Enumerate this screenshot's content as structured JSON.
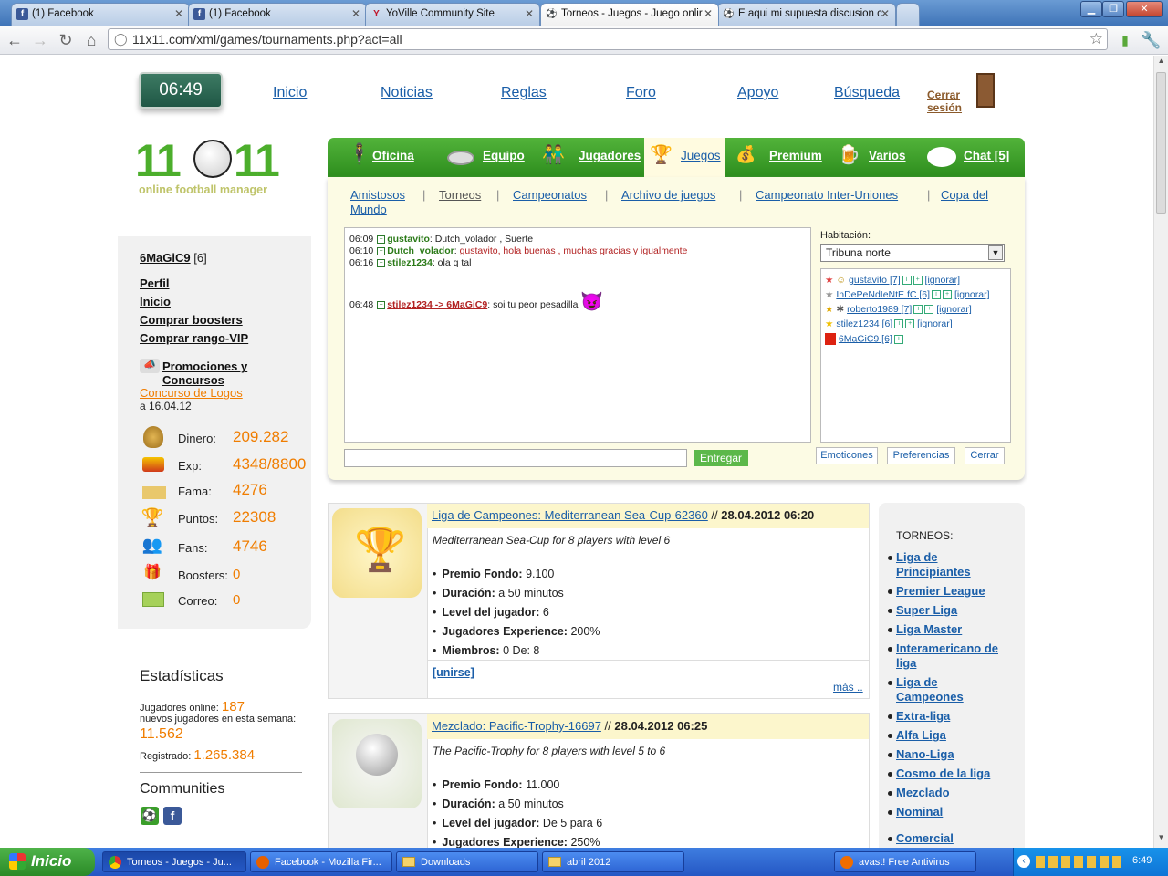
{
  "browser": {
    "tabs": [
      {
        "label": "(1) Facebook",
        "icon": "facebook-icon",
        "color": "#3b5998"
      },
      {
        "label": "(1) Facebook",
        "icon": "facebook-icon",
        "color": "#3b5998"
      },
      {
        "label": "YoVille Community Site",
        "icon": "yoville-icon",
        "color": "#c0152a"
      },
      {
        "label": "Torneos - Juegos - Juego onlir",
        "icon": "soccer-ball-icon",
        "color": "#000000"
      },
      {
        "label": "E aqui mi supuesta discusion c",
        "icon": "soccer-ball-icon",
        "color": "#000000"
      }
    ],
    "url": "11x11.com/xml/games/tournaments.php?act=all"
  },
  "header": {
    "clock": "06:49",
    "nav": [
      "Inicio",
      "Noticias",
      "Reglas",
      "Foro",
      "Apoyo",
      "Búsqueda"
    ],
    "logout": "Cerrar sesión",
    "logo_number_left": "11",
    "logo_number_right": "11",
    "logo_subtitle": "online football manager"
  },
  "sidebar": {
    "user": "6MaGiC9",
    "level": "[6]",
    "links": [
      "Perfil",
      "Inicio",
      "Comprar boosters",
      "Comprar rango-VIP"
    ],
    "promo": "Promociones y Concursos",
    "contest_link": "Concurso de Logos",
    "contest_date": "a 16.04.12",
    "stats": [
      {
        "label": "Dinero:",
        "value": "209.282",
        "icon": "money-bag-icon"
      },
      {
        "label": "Exp:",
        "value": "4348/8800",
        "icon": "exp-bars-icon"
      },
      {
        "label": "Fama:",
        "value": "4276",
        "icon": "podium-icon"
      },
      {
        "label": "Puntos:",
        "value": "22308",
        "icon": "trophy-icon"
      },
      {
        "label": "Fans:",
        "value": "4746",
        "icon": "fans-icon"
      },
      {
        "label": "Boosters:",
        "value": "0",
        "icon": "gift-icon"
      },
      {
        "label": "Correo:",
        "value": "0",
        "icon": "envelope-icon"
      }
    ],
    "estadisticas": {
      "title": "Estadísticas",
      "online_label": "Jugadores online:",
      "online_value": "187",
      "new_label": "nuevos jugadores en esta semana:",
      "new_value": "11.562",
      "reg_label": "Registrado:",
      "reg_value": "1.265.384"
    },
    "communities": "Communities"
  },
  "menu": {
    "items": [
      {
        "label": "Oficina",
        "icon": "manager-icon"
      },
      {
        "label": "Equipo",
        "icon": "stadium-icon"
      },
      {
        "label": "Jugadores",
        "icon": "players-icon"
      },
      {
        "label": "Juegos",
        "icon": "trophy-ball-icon"
      },
      {
        "label": "Premium",
        "icon": "premium-icon"
      },
      {
        "label": "Varios",
        "icon": "beer-icon"
      },
      {
        "label": "Chat [5]",
        "icon": "chat-bubble-icon"
      }
    ],
    "subtabs": [
      "Amistosos",
      "Torneos",
      "Campeonatos",
      "Archivo de juegos",
      "Campeonato Inter-Uniones",
      "Copa del",
      "Mundo"
    ]
  },
  "chat": {
    "messages": [
      {
        "time": "06:09",
        "user": "gustavito",
        "text": "Dutch_volador , Suerte",
        "red": false
      },
      {
        "time": "06:10",
        "user": "Dutch_volador",
        "text": "gustavito, hola buenas , muchas gracias y igualmente",
        "red": true
      },
      {
        "time": "06:16",
        "user": "stilez1234",
        "text": "ola q tal",
        "red": false
      },
      {
        "time": "06:48",
        "user": "stilez1234 -> 6MaGiC9",
        "text": "soi tu peor pesadilla",
        "red": false
      }
    ],
    "room_label": "Habitación:",
    "room_value": "Tribuna norte",
    "users": [
      {
        "name": "gustavito [7]",
        "ignore": "[ignorar]"
      },
      {
        "name": "InDePeNdIeNtE fC [6]",
        "ignore": "[ignorar]"
      },
      {
        "name": "roberto1989 [7]",
        "ignore": "[ignorar]"
      },
      {
        "name": "stilez1234 [6]",
        "ignore": "[ignorar]"
      },
      {
        "name": "6MaGiC9 [6]",
        "ignore": ""
      }
    ],
    "send": "Entregar",
    "buttons": [
      "Emoticones",
      "Preferencias",
      "Cerrar"
    ]
  },
  "tournaments": [
    {
      "title": "Liga de Campeones: Mediterranean Sea-Cup-62360",
      "date": "28.04.2012 06:20",
      "desc": "Mediterranean Sea-Cup for 8 players with level 6",
      "items": [
        {
          "k": "Premio Fondo:",
          "v": "9.100"
        },
        {
          "k": "Duración:",
          "v": "a 50 minutos"
        },
        {
          "k": "Level del jugador:",
          "v": "6"
        },
        {
          "k": "Jugadores Experience:",
          "v": "200%"
        },
        {
          "k": "Miembros:",
          "v": "0 De: 8"
        }
      ],
      "join": "[unirse]",
      "more": "más .."
    },
    {
      "title": "Mezclado: Pacific-Trophy-16697",
      "date": "28.04.2012 06:25",
      "desc": "The Pacific-Trophy for 8 players with level 5 to 6",
      "items": [
        {
          "k": "Premio Fondo:",
          "v": "11.000"
        },
        {
          "k": "Duración:",
          "v": "a 50 minutos"
        },
        {
          "k": "Level del jugador:",
          "v": "De 5 para 6"
        },
        {
          "k": "Jugadores Experience:",
          "v": "250%"
        }
      ]
    }
  ],
  "torneos": {
    "title": "TORNEOS:",
    "links": [
      "Liga de Principiantes",
      "Premier League",
      "Super Liga",
      "Liga Master",
      "Interamericano de liga",
      "Liga de Campeones",
      "Extra-liga",
      "Alfa Liga",
      "Nano-Liga",
      "Cosmo de la liga",
      "Mezclado",
      "Nominal",
      "Comercial"
    ]
  },
  "taskbar": {
    "start": "Inicio",
    "items": [
      "Torneos - Juegos - Ju...",
      "Facebook - Mozilla Fir...",
      "Downloads",
      "abril 2012",
      "avast! Free Antivirus"
    ],
    "time": "6:49"
  },
  "colors": {
    "green": "#3a9e2a",
    "orange": "#f07d00",
    "link": "#1a5ea8"
  }
}
